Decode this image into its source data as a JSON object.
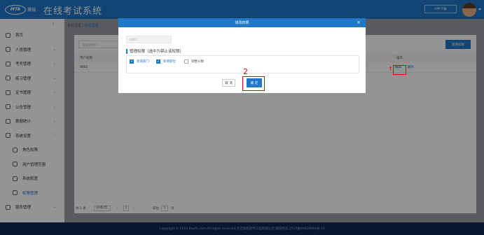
{
  "header": {
    "logo_badge": "MTA",
    "logo_text": "赛瑞",
    "title": "在线考试系统",
    "app_download": "APP下载",
    "colors": {
      "primary": "#1f78c8",
      "footer": "#0e2a55",
      "annotation": "#e60012"
    }
  },
  "sidebar": {
    "collapse_icon": "‹",
    "items": [
      {
        "label": "首页",
        "icon": "home-icon"
      },
      {
        "label": "人员管理",
        "icon": "user-icon",
        "chevron": "⌄"
      },
      {
        "label": "考务管理",
        "icon": "exam-icon",
        "chevron": "⌄"
      },
      {
        "label": "练习管理",
        "icon": "practice-icon",
        "chevron": "⌄"
      },
      {
        "label": "证书管理",
        "icon": "certificate-icon",
        "chevron": "⌄"
      },
      {
        "label": "公告管理",
        "icon": "notice-icon",
        "chevron": "⌄"
      },
      {
        "label": "数据统计",
        "icon": "chart-icon",
        "chevron": "⌄"
      },
      {
        "label": "系统设置",
        "icon": "settings-icon",
        "chevron": "⌃"
      },
      {
        "label": "角色权限",
        "icon": "role-icon",
        "sub": true
      },
      {
        "label": "用户管理范围",
        "icon": "scope-icon",
        "sub": true
      },
      {
        "label": "系统配置",
        "icon": "config-icon",
        "sub": true
      },
      {
        "label": "权限管理",
        "icon": "permission-icon",
        "sub": true,
        "active": true
      },
      {
        "label": "服务管理",
        "icon": "service-icon",
        "chevron": "⌄"
      }
    ]
  },
  "breadcrumb": {
    "parent": "系统设置",
    "separator": "/",
    "current": "权限配置"
  },
  "panel": {
    "search_placeholder": "请搜索用户",
    "add_button": "新增权限",
    "columns": {
      "user": "用户名称",
      "op": "操作"
    },
    "rows": [
      {
        "user": "0001",
        "edit": "编辑",
        "delete": "删除"
      }
    ],
    "arrow": "↑",
    "pager": {
      "total": "共 1 条",
      "size": "10条/页",
      "prev": "‹",
      "page": "1",
      "next": "›",
      "goto": "前往",
      "goto_value": "1",
      "page_suffix": "页"
    }
  },
  "modal": {
    "title": "修改权限",
    "close": "×",
    "user_value": "0001",
    "section_label": "管理权限（选中为禁止该权限）",
    "permissions": [
      {
        "label": "新增部门",
        "checked": true
      },
      {
        "label": "新增职位",
        "checked": true
      },
      {
        "label": "调整分数",
        "checked": false
      }
    ],
    "cancel": "取 消",
    "confirm": "确 定",
    "step_marker": "2"
  },
  "footer": {
    "text": "Copyright © 2019 Boufh.com All rights reserved 大连瑞和软件工程有限公司 版权所有 辽ICP备09020949号-19"
  }
}
